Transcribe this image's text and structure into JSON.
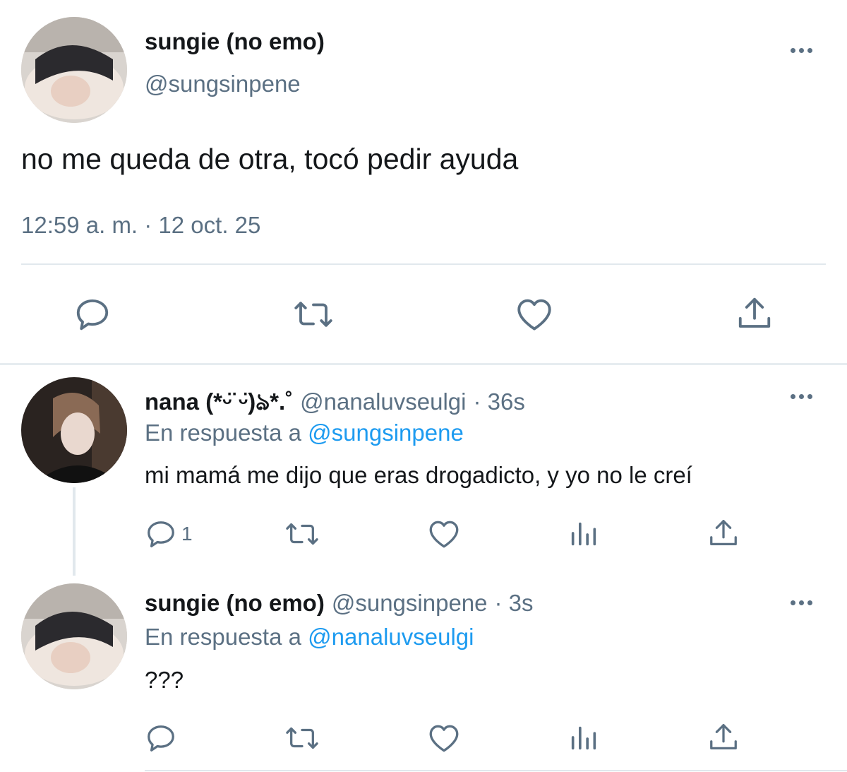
{
  "main_tweet": {
    "author_name": "sungie (no emo)",
    "author_handle": "@sungsinpene",
    "text": "no me queda de otra, tocó pedir ayuda",
    "timestamp": "12:59 a. m. · 12 oct. 25"
  },
  "replies": [
    {
      "author_name": "nana (*ᵕ̈ ᵕ̈)ঌ*.˚",
      "author_handle": "@nanaluvseulgi",
      "time": "· 36s",
      "reply_prefix": "En respuesta a",
      "reply_to": "@sungsinpene",
      "text": "mi mamá me dijo que eras drogadicto, y yo no le creí",
      "reply_count": "1"
    },
    {
      "author_name": "sungie (no emo)",
      "author_handle": "@sungsinpene",
      "time": "· 3s",
      "reply_prefix": "En respuesta a",
      "reply_to": "@nanaluvseulgi",
      "text": "???"
    }
  ],
  "icons": {
    "reply": "reply-icon",
    "retweet": "retweet-icon",
    "like": "heart-icon",
    "share": "share-icon",
    "analytics": "analytics-icon",
    "more": "more-icon"
  },
  "colors": {
    "link": "#1d9bf0",
    "secondary_text": "#5b7083",
    "divider": "#e1e8ed"
  }
}
